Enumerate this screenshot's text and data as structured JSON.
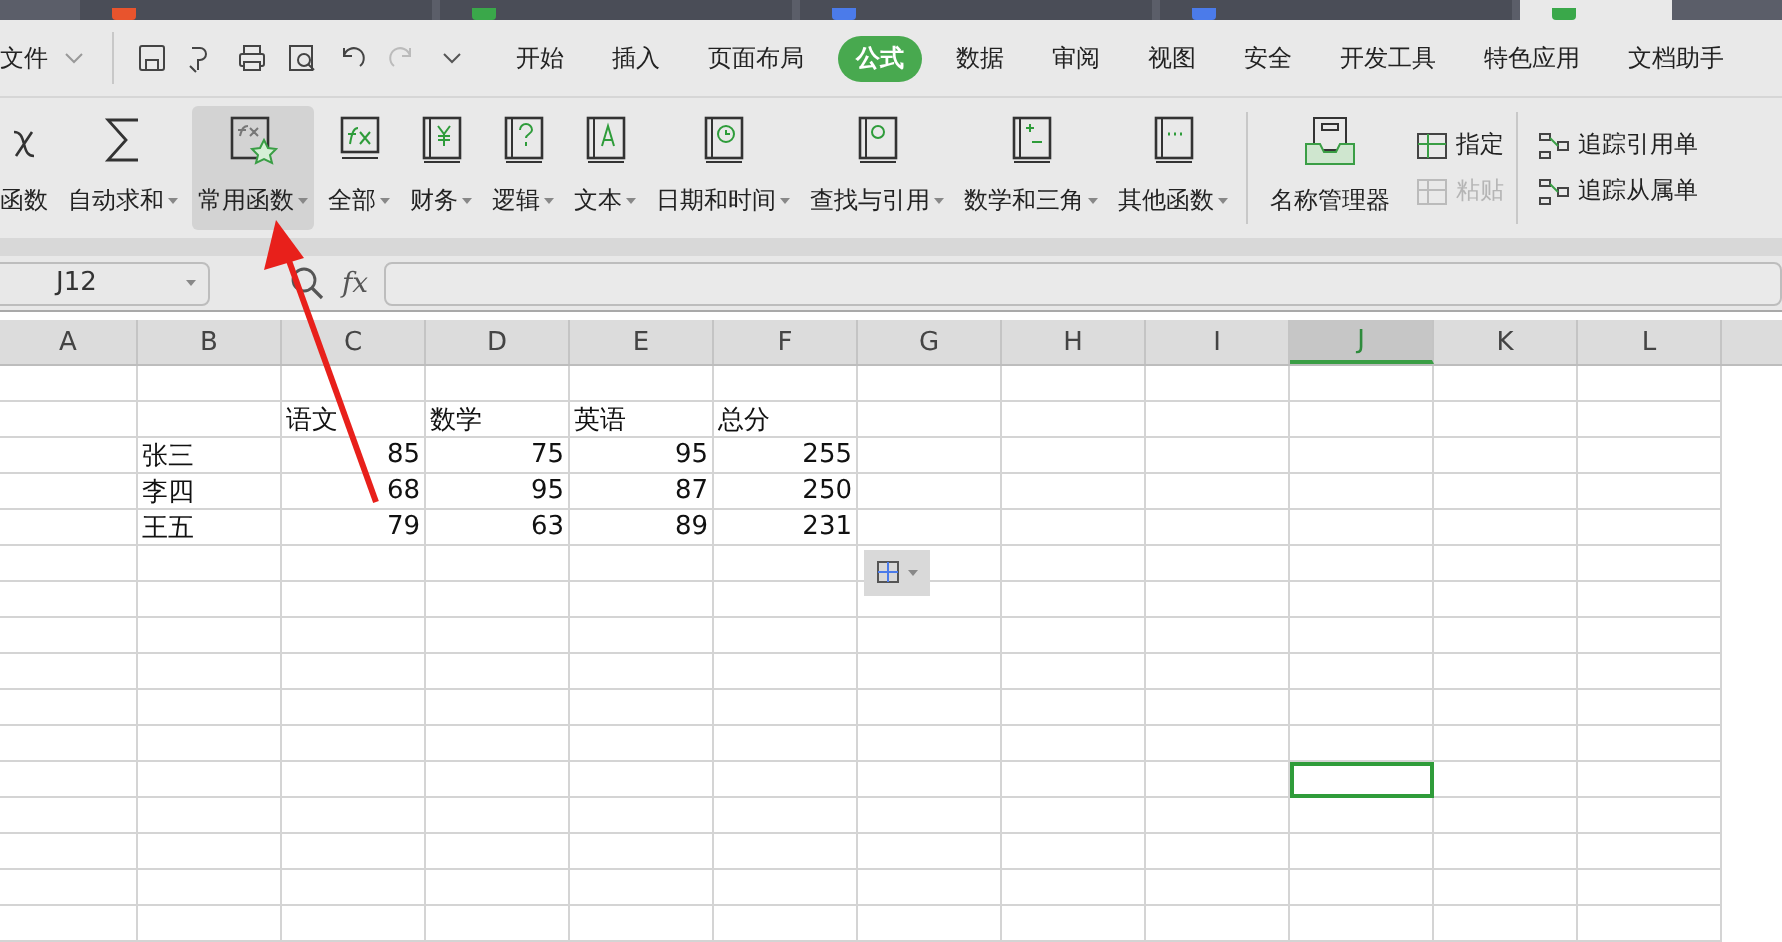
{
  "doc_tabs": [
    {
      "selected": false,
      "color": "#e8542d"
    },
    {
      "selected": false,
      "color": "#3aa84a"
    },
    {
      "selected": false,
      "color": "#4b7bea"
    },
    {
      "selected": false,
      "color": "#4b7bea"
    },
    {
      "selected": true,
      "color": "#3aa84a"
    }
  ],
  "menu": {
    "file": "文件",
    "tabs": [
      {
        "label": "开始",
        "selected": false
      },
      {
        "label": "插入",
        "selected": false
      },
      {
        "label": "页面布局",
        "selected": false
      },
      {
        "label": "公式",
        "selected": true
      },
      {
        "label": "数据",
        "selected": false
      },
      {
        "label": "审阅",
        "selected": false
      },
      {
        "label": "视图",
        "selected": false
      },
      {
        "label": "安全",
        "selected": false
      },
      {
        "label": "开发工具",
        "selected": false
      },
      {
        "label": "特色应用",
        "selected": false
      },
      {
        "label": "文档助手",
        "selected": false
      }
    ]
  },
  "ribbon": {
    "items": [
      {
        "label": "函数",
        "kind": "fx",
        "dropdown": false,
        "selected": false
      },
      {
        "label": "自动求和",
        "kind": "sigma",
        "dropdown": true,
        "selected": false
      },
      {
        "label": "常用函数",
        "kind": "fxstar",
        "dropdown": true,
        "selected": true
      },
      {
        "label": "全部",
        "kind": "fxgreen",
        "dropdown": true,
        "selected": false
      },
      {
        "label": "财务",
        "kind": "yen",
        "dropdown": true,
        "selected": false
      },
      {
        "label": "逻辑",
        "kind": "question",
        "dropdown": true,
        "selected": false
      },
      {
        "label": "文本",
        "kind": "letter",
        "dropdown": true,
        "selected": false
      },
      {
        "label": "日期和时间",
        "kind": "clock",
        "dropdown": true,
        "selected": false
      },
      {
        "label": "查找与引用",
        "kind": "search",
        "dropdown": true,
        "selected": false
      },
      {
        "label": "数学和三角",
        "kind": "plusminus",
        "dropdown": true,
        "selected": false
      },
      {
        "label": "其他函数",
        "kind": "dots",
        "dropdown": true,
        "selected": false
      },
      {
        "label": "名称管理器",
        "kind": "tray",
        "dropdown": false,
        "selected": false
      }
    ],
    "small": [
      {
        "label": "指定",
        "disabled": false
      },
      {
        "label": "粘贴",
        "disabled": true
      }
    ],
    "trace": [
      {
        "label": "追踪引用单"
      },
      {
        "label": "追踪从属单"
      }
    ]
  },
  "formula_bar": {
    "name_box": "J12",
    "fx": "fx"
  },
  "sheet": {
    "columns": [
      {
        "label": "A",
        "selected": false
      },
      {
        "label": "B",
        "selected": false
      },
      {
        "label": "C",
        "selected": false
      },
      {
        "label": "D",
        "selected": false
      },
      {
        "label": "E",
        "selected": false
      },
      {
        "label": "F",
        "selected": false
      },
      {
        "label": "G",
        "selected": false
      },
      {
        "label": "H",
        "selected": false
      },
      {
        "label": "I",
        "selected": false
      },
      {
        "label": "J",
        "selected": true
      },
      {
        "label": "K",
        "selected": false
      },
      {
        "label": "L",
        "selected": false
      }
    ],
    "rows": [
      {
        "selected": false
      },
      {
        "selected": false,
        "cells": [
          null,
          null,
          {
            "text": "语文",
            "kind": "text"
          },
          {
            "text": "数学",
            "kind": "text"
          },
          {
            "text": "英语",
            "kind": "text"
          },
          {
            "text": "总分",
            "kind": "text"
          }
        ]
      },
      {
        "selected": false,
        "cells": [
          null,
          {
            "text": "张三",
            "kind": "text"
          },
          {
            "text": "85",
            "kind": "number"
          },
          {
            "text": "75",
            "kind": "number"
          },
          {
            "text": "95",
            "kind": "number"
          },
          {
            "text": "255",
            "kind": "number"
          }
        ]
      },
      {
        "selected": false,
        "cells": [
          null,
          {
            "text": "李四",
            "kind": "text"
          },
          {
            "text": "68",
            "kind": "number"
          },
          {
            "text": "95",
            "kind": "number"
          },
          {
            "text": "87",
            "kind": "number"
          },
          {
            "text": "250",
            "kind": "number"
          }
        ]
      },
      {
        "selected": false,
        "cells": [
          null,
          {
            "text": "王五",
            "kind": "text"
          },
          {
            "text": "79",
            "kind": "number"
          },
          {
            "text": "63",
            "kind": "number"
          },
          {
            "text": "89",
            "kind": "number"
          },
          {
            "text": "231",
            "kind": "number"
          }
        ]
      },
      {
        "selected": false
      },
      {
        "selected": false
      },
      {
        "selected": false
      },
      {
        "selected": false
      },
      {
        "selected": false
      },
      {
        "selected": false
      },
      {
        "selected": true
      },
      {
        "selected": false
      },
      {
        "selected": false
      },
      {
        "selected": false
      },
      {
        "selected": false
      }
    ]
  }
}
